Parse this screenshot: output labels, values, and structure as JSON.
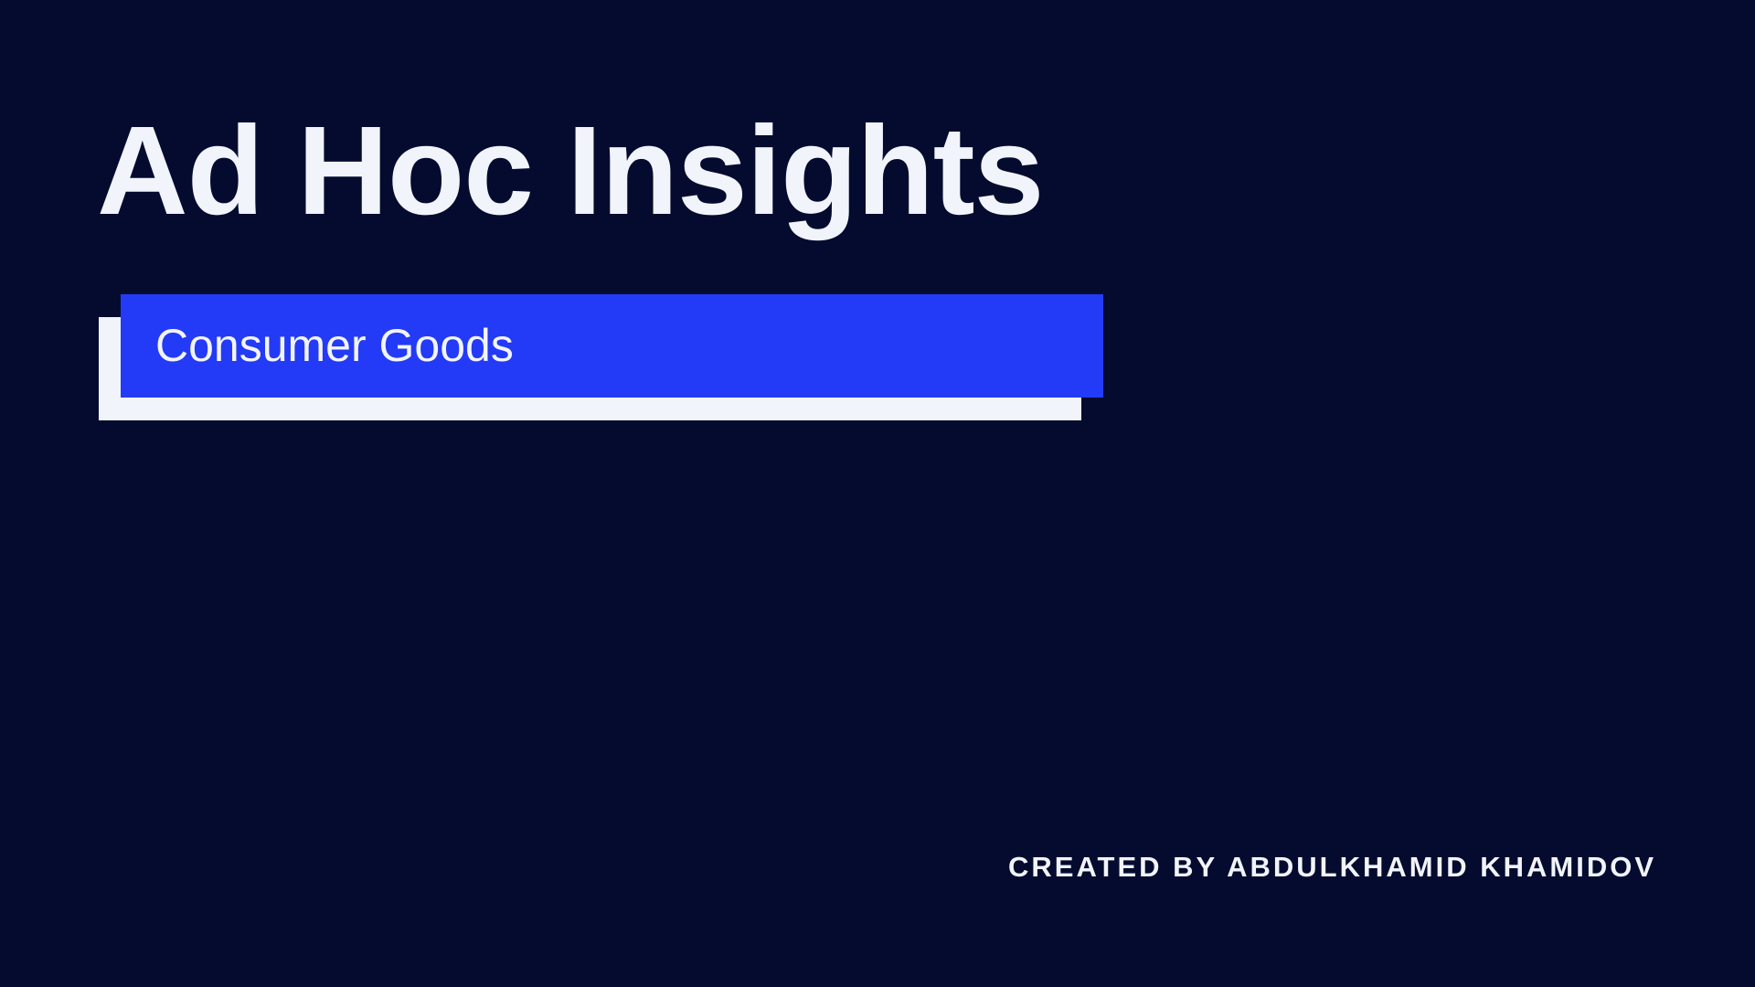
{
  "slide": {
    "title": "Ad Hoc Insights",
    "subtitle": "Consumer Goods",
    "credit": "CREATED BY ABDULKHAMID KHAMIDOV"
  },
  "colors": {
    "background": "#040b2f",
    "accent_blue": "#233bf7",
    "text_light": "#f2f4fb"
  }
}
